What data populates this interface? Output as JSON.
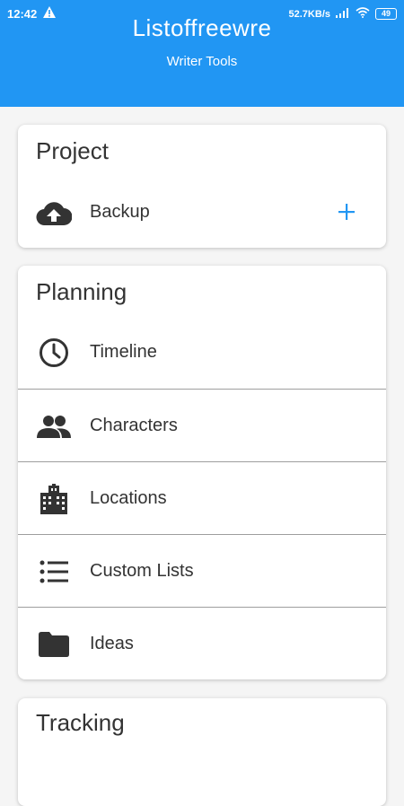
{
  "status_bar": {
    "time": "12:42",
    "speed": "52.7KB/s",
    "battery": "49"
  },
  "app": {
    "title": "Listoffreewre",
    "subtitle": "Writer Tools"
  },
  "project": {
    "title": "Project",
    "backup": {
      "label": "Backup",
      "icon": "cloud-upload-icon"
    }
  },
  "planning": {
    "title": "Planning",
    "items": [
      {
        "label": "Timeline",
        "icon": "clock-icon"
      },
      {
        "label": "Characters",
        "icon": "people-icon"
      },
      {
        "label": "Locations",
        "icon": "city-icon"
      },
      {
        "label": "Custom Lists",
        "icon": "list-icon"
      },
      {
        "label": "Ideas",
        "icon": "folder-icon"
      }
    ]
  },
  "next_card": {
    "title": "Tracking"
  },
  "colors": {
    "accent": "#2196f3",
    "icon": "#333333"
  }
}
